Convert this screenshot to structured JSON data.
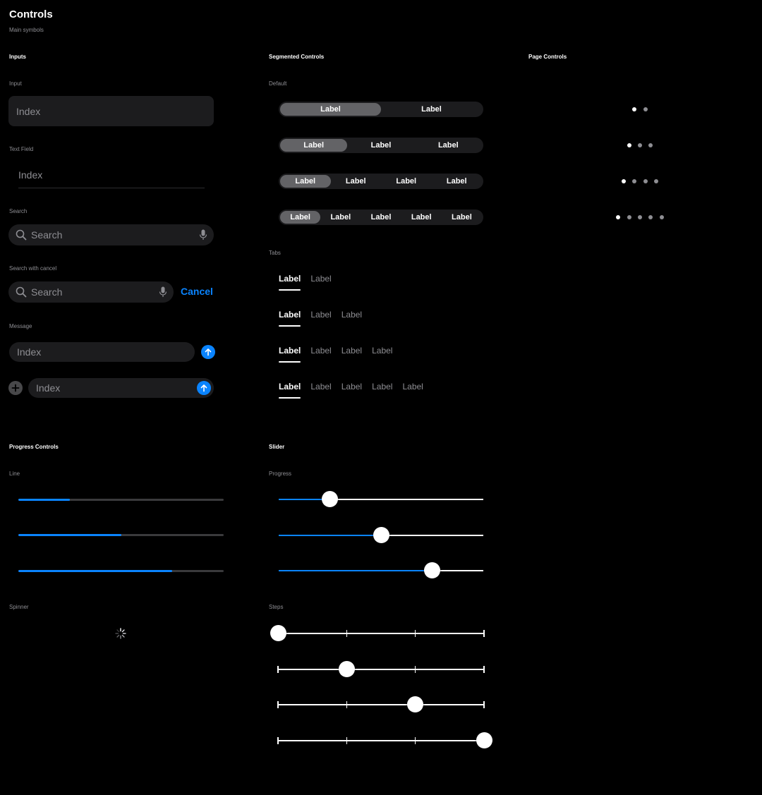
{
  "header": {
    "title": "Controls",
    "subtitle": "Main symbols"
  },
  "inputs": {
    "heading": "Inputs",
    "input": {
      "label": "Input",
      "placeholder": "Index"
    },
    "text_field": {
      "label": "Text Field",
      "placeholder": "Index"
    },
    "search": {
      "label": "Search",
      "placeholder": "Search"
    },
    "search_cancel": {
      "label": "Search with cancel",
      "placeholder": "Search",
      "cancel": "Cancel"
    },
    "message": {
      "label": "Message",
      "placeholder1": "Index",
      "placeholder2": "Index"
    }
  },
  "segmented": {
    "heading": "Segmented Controls",
    "default_label": "Default",
    "segment_label": "Label",
    "rows": [
      2,
      3,
      4,
      5
    ]
  },
  "tabs": {
    "label": "Tabs",
    "tab_label": "Label",
    "rows": [
      2,
      3,
      4,
      5
    ]
  },
  "page_controls": {
    "heading": "Page Controls",
    "rows": [
      2,
      3,
      4,
      5
    ]
  },
  "progress": {
    "heading": "Progress Controls",
    "line_label": "Line",
    "values": [
      0.25,
      0.5,
      0.75
    ],
    "spinner_label": "Spinner"
  },
  "slider": {
    "heading": "Slider",
    "progress_label": "Progress",
    "progress_values": [
      0.25,
      0.5,
      0.75
    ],
    "steps_label": "Steps",
    "step_positions": [
      0,
      1,
      2,
      3
    ],
    "step_count": 3
  },
  "colors": {
    "accent": "#0a84ff",
    "background": "#000000",
    "field": "#1c1c1e"
  }
}
